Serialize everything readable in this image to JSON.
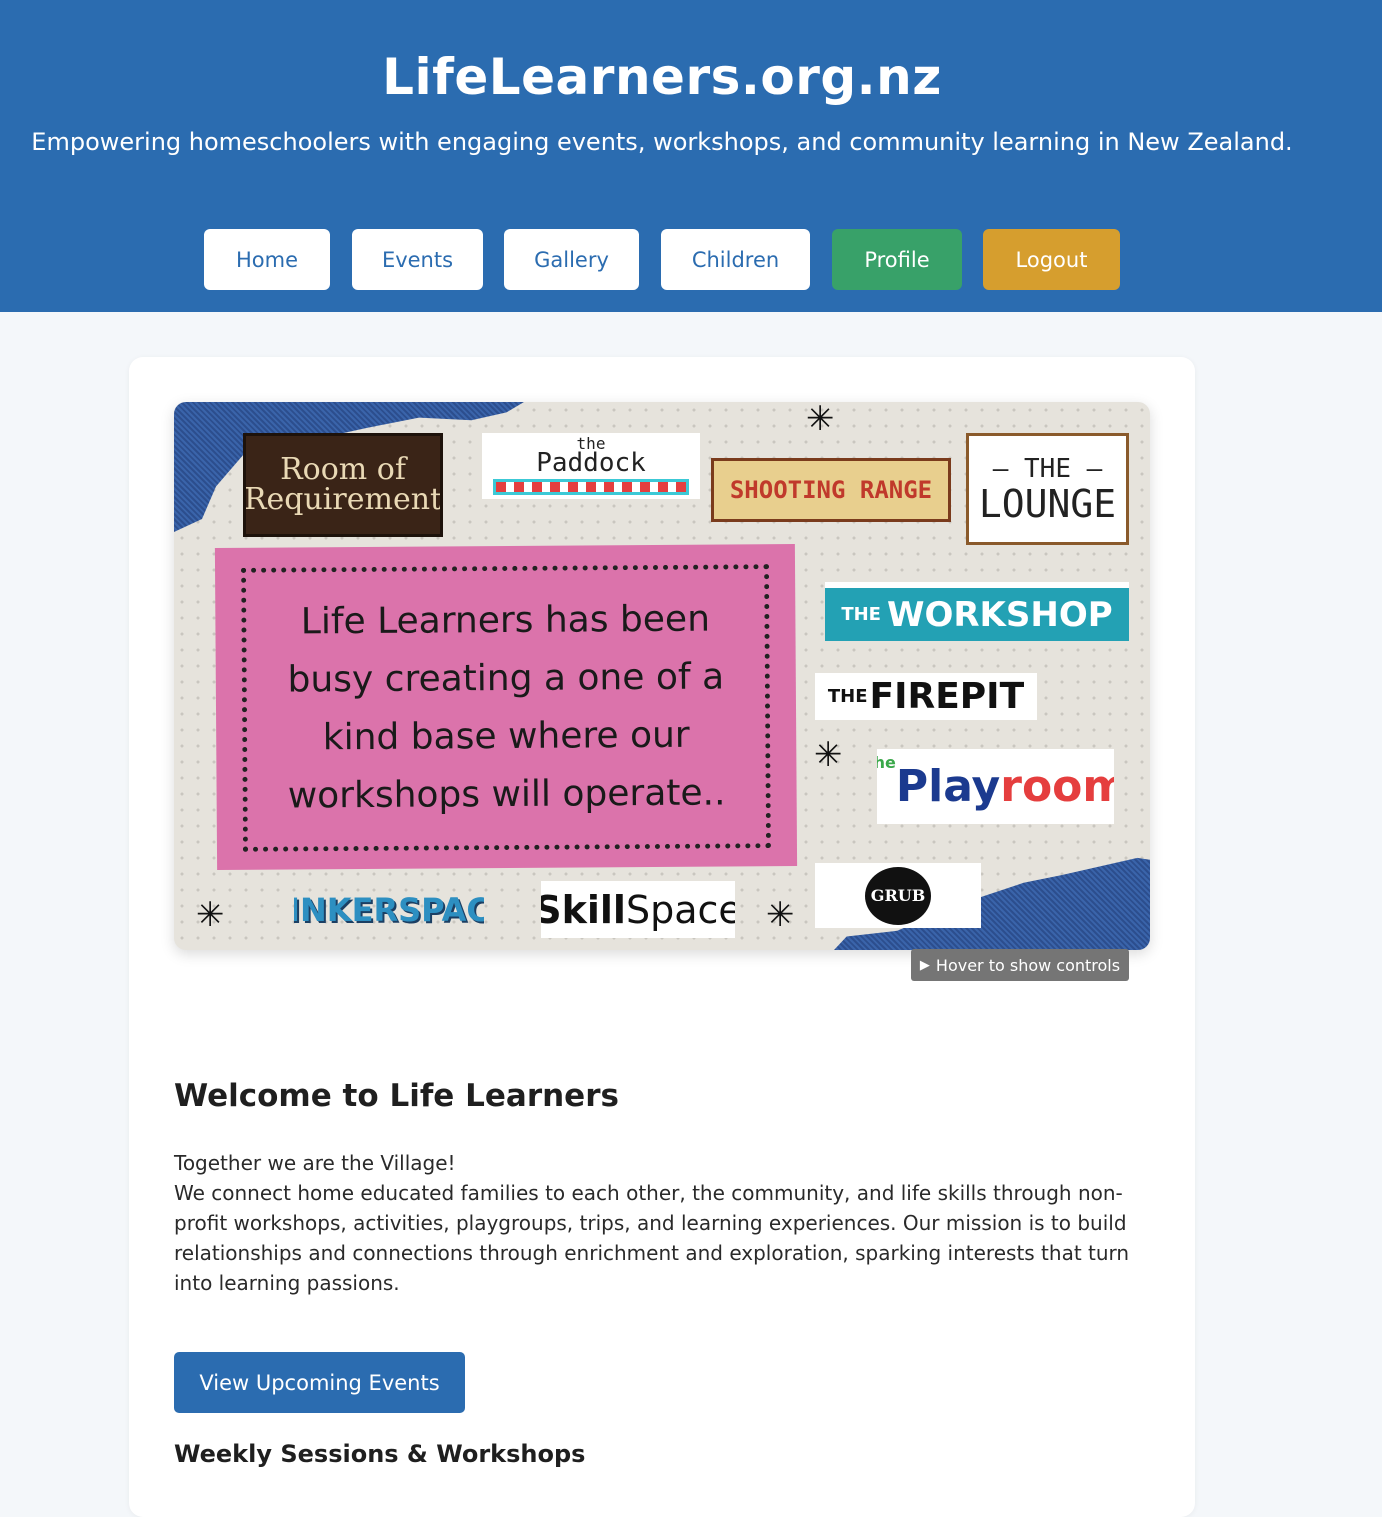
{
  "header": {
    "title": "LifeLearners.org.nz",
    "tagline": "Empowering homeschoolers with engaging events, workshops, and community learning in New Zealand."
  },
  "nav": {
    "home": "Home",
    "events": "Events",
    "gallery": "Gallery",
    "children": "Children",
    "profile": "Profile",
    "logout": "Logout"
  },
  "colors": {
    "brand_blue": "#2b6cb0",
    "profile_green": "#38a169",
    "logout_gold": "#d69e2e",
    "note_pink": "#db73ab"
  },
  "video": {
    "signs": {
      "room_of_requirement": "Room of Requirement",
      "paddock_small": "the",
      "paddock": "Paddock",
      "shooting_range": "SHOOTING RANGE",
      "lounge_top": "— THE —",
      "lounge": "LOUNGE",
      "workshop_pre": "THE",
      "workshop": "WORKSHOP",
      "firepit_pre": "THE",
      "firepit": "FIREPIT",
      "playroom_pre": "The",
      "playroom_play": "Play",
      "playroom_room": "room",
      "grub": "GRUB",
      "tinkerspace": "TINKERSPACE",
      "skill_bold": "Skill",
      "skill_rest": "Space"
    },
    "note": "Life Learners has been busy creating a one of a kind base where our workshops will operate..",
    "hover_hint": "Hover to show controls",
    "play_icon": "play-icon"
  },
  "welcome": {
    "title": "Welcome to Life Learners",
    "line1": "Together we are the Village!",
    "paragraph": "We connect home educated families to each other, the community, and life skills through non-profit workshops, activities, playgroups, trips, and learning experiences. Our mission is to build relationships and connections through enrichment and exploration, sparking interests that turn into learning passions."
  },
  "cta": {
    "label": "View Upcoming Events"
  },
  "weekly": {
    "title": "Weekly Sessions & Workshops"
  }
}
